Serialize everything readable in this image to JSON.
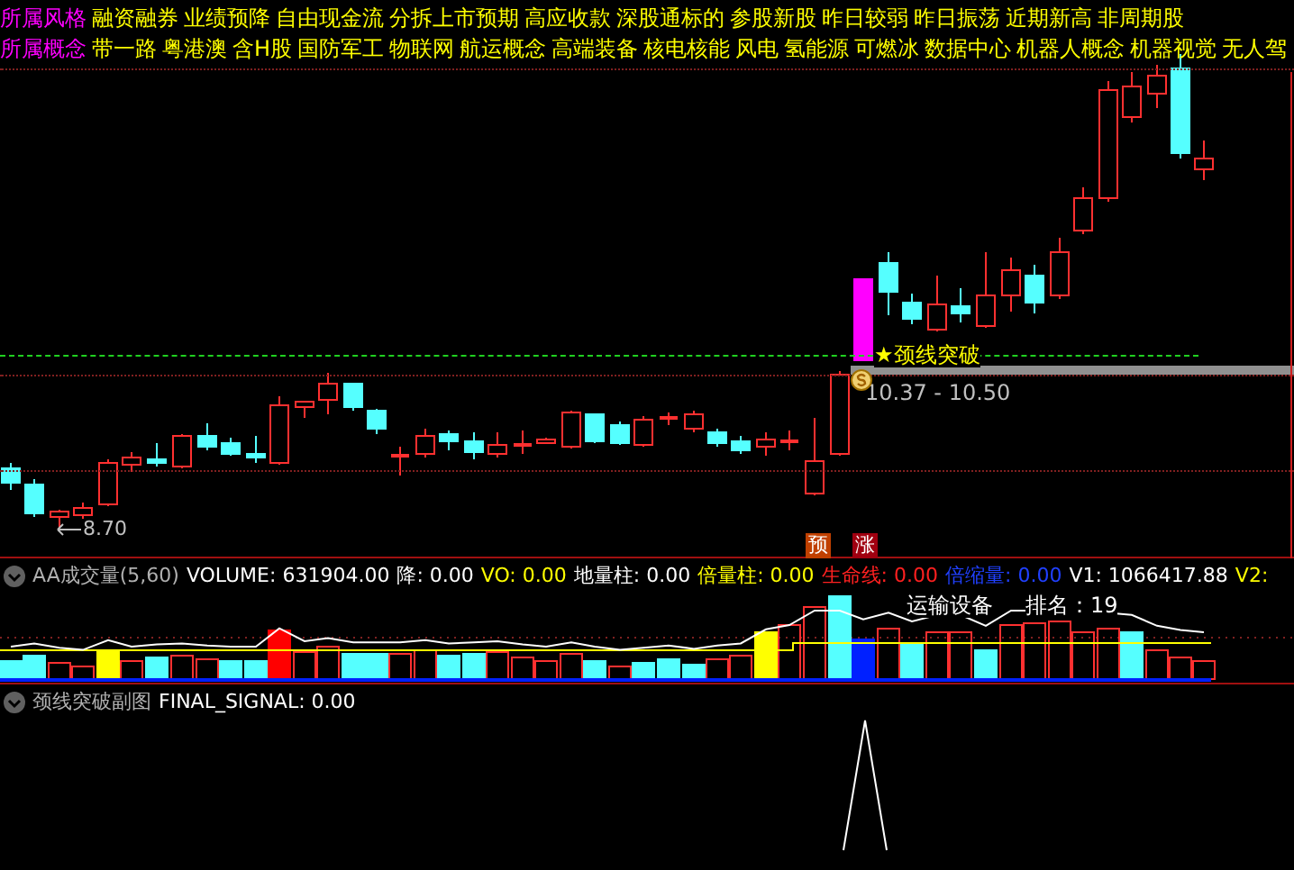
{
  "header": {
    "rows": [
      {
        "label": "所属风格",
        "tags": [
          "融资融券",
          "业绩预降",
          "自由现金流",
          "分拆上市预期",
          "高应收款",
          "深股通标的",
          "参股新股",
          "昨日较弱",
          "昨日振荡",
          "近期新高",
          "非周期股"
        ]
      },
      {
        "label": "所属概念",
        "tags": [
          "带一路",
          "粤港澳",
          "含H股",
          "国防军工",
          "物联网",
          "航运概念",
          "高端装备",
          "核电核能",
          "风电",
          "氢能源",
          "可燃冰",
          "数据中心",
          "机器人概念",
          "机器视觉",
          "无人驾"
        ]
      }
    ]
  },
  "price_chart": {
    "neckline_label": "★颈线突破",
    "price_range": "10.37 - 10.50",
    "low_label": "8.70",
    "badges": [
      {
        "text": "预",
        "color": "#c04000"
      },
      {
        "text": "涨",
        "color": "#a00010"
      }
    ]
  },
  "volume_panel": {
    "title": "AA成交量(5,60)",
    "indicators": [
      {
        "text": "VOLUME: 631904.00",
        "color": "#ffffff"
      },
      {
        "text": "降: 0.00",
        "color": "#ffffff"
      },
      {
        "text": "VO: 0.00",
        "color": "#ffff00"
      },
      {
        "text": "地量柱: 0.00",
        "color": "#ffffff"
      },
      {
        "text": "倍量柱: 0.00",
        "color": "#ffff00"
      },
      {
        "text": "生命线: 0.00",
        "color": "#ff2020"
      },
      {
        "text": "倍缩量: 0.00",
        "color": "#2040ff"
      },
      {
        "text": "V1: 1066417.88",
        "color": "#ffffff"
      },
      {
        "text": "V2:",
        "color": "#ffff00"
      }
    ],
    "sector": "运输设备",
    "rank": "排名：19"
  },
  "signal_panel": {
    "title": "颈线突破副图",
    "indicators": [
      {
        "text": "FINAL_SIGNAL: 0.00",
        "color": "#ffffff"
      }
    ]
  }
}
